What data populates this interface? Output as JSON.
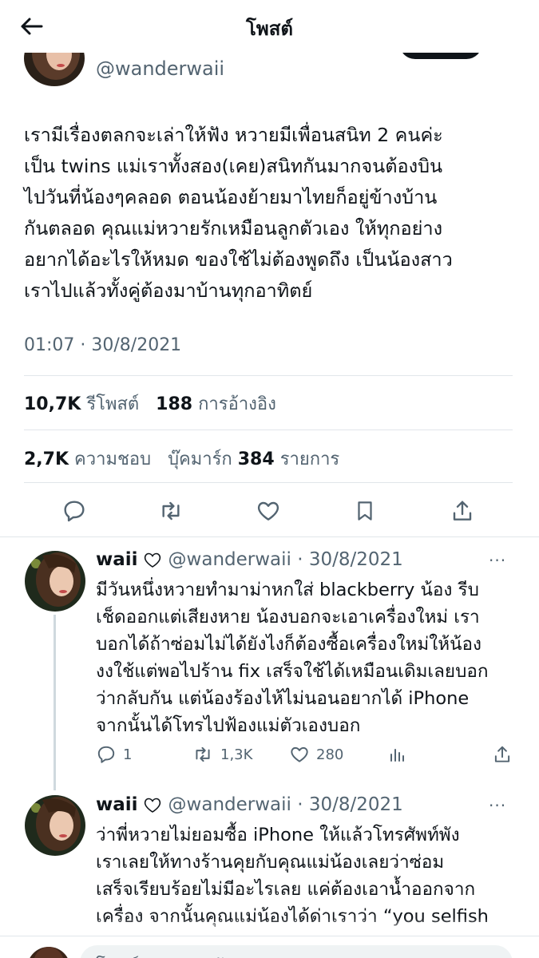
{
  "header": {
    "title": "โพสต์",
    "back_icon": "arrow-left-icon"
  },
  "main_post": {
    "handle": "@wanderwaii",
    "text_lines": [
      "เรามีเรื่องตลกจะเล่าให้ฟัง หวายมีเพื่อนสนิท 2 คนค่ะ",
      "เป็น twins แม่เราทั้งสอง(เคย)สนิทกันมากจนต้องบิน",
      "ไปวันที่น้องๆคลอด ตอนน้องย้ายมาไทยก็อยู่ข้างบ้าน",
      "กันตลอด คุณแม่หวายรักเหมือนลูกตัวเอง ให้ทุกอย่าง",
      "อยากได้อะไรให้หมด ของใช้ไม่ต้องพูดถึง เป็นน้องสาว",
      "เราไปแล้วทั้งคู่ต้องมาบ้านทุกอาทิตย์"
    ],
    "timestamp": "01:07 · 30/8/2021",
    "stats": {
      "reposts_count": "10,7K",
      "reposts_label": "รีโพสต์",
      "quotes_count": "188",
      "quotes_label": "การอ้างอิง",
      "likes_count": "2,7K",
      "likes_label": "ความชอบ",
      "bookmarks_label": "บุ๊คมาร์ก",
      "bookmarks_count": "384",
      "bookmarks_suffix": "รายการ"
    }
  },
  "replies": [
    {
      "name": "waii",
      "handle_date": "@wanderwaii · 30/8/2021",
      "more": "···",
      "text_lines": [
        "มีวันหนึ่งหวายทำมาม่าหกใส่ blackberry น้อง รีบ",
        "เช็ดออกแต่เสียงหาย น้องบอกจะเอาเครื่องใหม่ เรา",
        "บอกได้ถ้าซ่อมไม่ได้ยังไงก็ต้องซื้อเครื่องใหม่ให้น้อง",
        "งงใช้แต่พอไปร้าน fix เสร็จใช้ได้เหมือนเดิมเลยบอก",
        "ว่ากลับกัน แต่น้องร้องไห้ไม่นอนอยากได้ iPhone",
        "จากนั้นได้โทรไปฟ้องแม่ตัวเองบอก"
      ],
      "reply_count": "1",
      "repost_count": "1,3K",
      "like_count": "280"
    },
    {
      "name": "waii",
      "handle_date": "@wanderwaii · 30/8/2021",
      "more": "···",
      "text_lines": [
        "ว่าพี่หวายไม่ยอมซื้อ iPhone ให้แล้วโทรศัพท์พัง",
        "เราเลยให้ทางร้านคุยกับคุณแม่น้องเลยว่าซ่อม",
        "เสร็จเรียบร้อยไม่มีอะไรเลย แค่ต้องเอาน้ำออกจาก",
        "เครื่อง จากนั้นคุณแม่น้องได้ด่าเราว่า “you selfish"
      ]
    }
  ],
  "compose": {
    "placeholder": "โพสต์การตอบกลับ"
  },
  "colors": {
    "text": "#0f1419",
    "secondary": "#536471",
    "divider": "#e1e6ea"
  }
}
